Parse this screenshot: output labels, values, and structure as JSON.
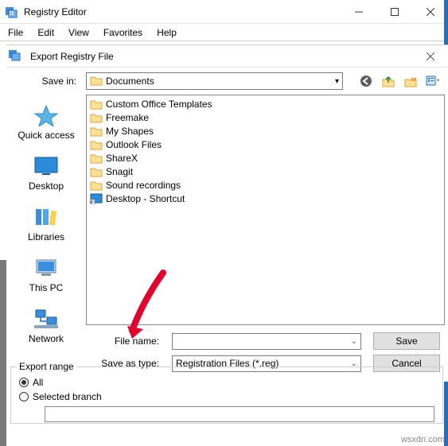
{
  "window": {
    "title": "Registry Editor",
    "menus": [
      "File",
      "Edit",
      "View",
      "Favorites",
      "Help"
    ]
  },
  "dialog": {
    "title": "Export Registry File",
    "save_in_label": "Save in:",
    "save_in_value": "Documents",
    "places": [
      {
        "id": "quick-access",
        "label": "Quick access"
      },
      {
        "id": "desktop",
        "label": "Desktop"
      },
      {
        "id": "libraries",
        "label": "Libraries"
      },
      {
        "id": "this-pc",
        "label": "This PC"
      },
      {
        "id": "network",
        "label": "Network"
      }
    ],
    "files": [
      {
        "type": "folder",
        "name": "Custom Office Templates"
      },
      {
        "type": "folder",
        "name": "Freemake"
      },
      {
        "type": "folder",
        "name": "My Shapes"
      },
      {
        "type": "folder",
        "name": "Outlook Files"
      },
      {
        "type": "folder",
        "name": "ShareX"
      },
      {
        "type": "folder",
        "name": "Snagit"
      },
      {
        "type": "folder",
        "name": "Sound recordings"
      },
      {
        "type": "shortcut",
        "name": "Desktop - Shortcut"
      }
    ],
    "file_name_label": "File name:",
    "file_name_value": "",
    "save_as_type_label": "Save as type:",
    "save_as_type_value": "Registration Files (*.reg)",
    "save_button": "Save",
    "cancel_button": "Cancel"
  },
  "export_range": {
    "legend": "Export range",
    "all_label": "All",
    "selected_label": "Selected branch",
    "selected_value": "",
    "checked": "all"
  },
  "watermark": "wsxdn.com"
}
